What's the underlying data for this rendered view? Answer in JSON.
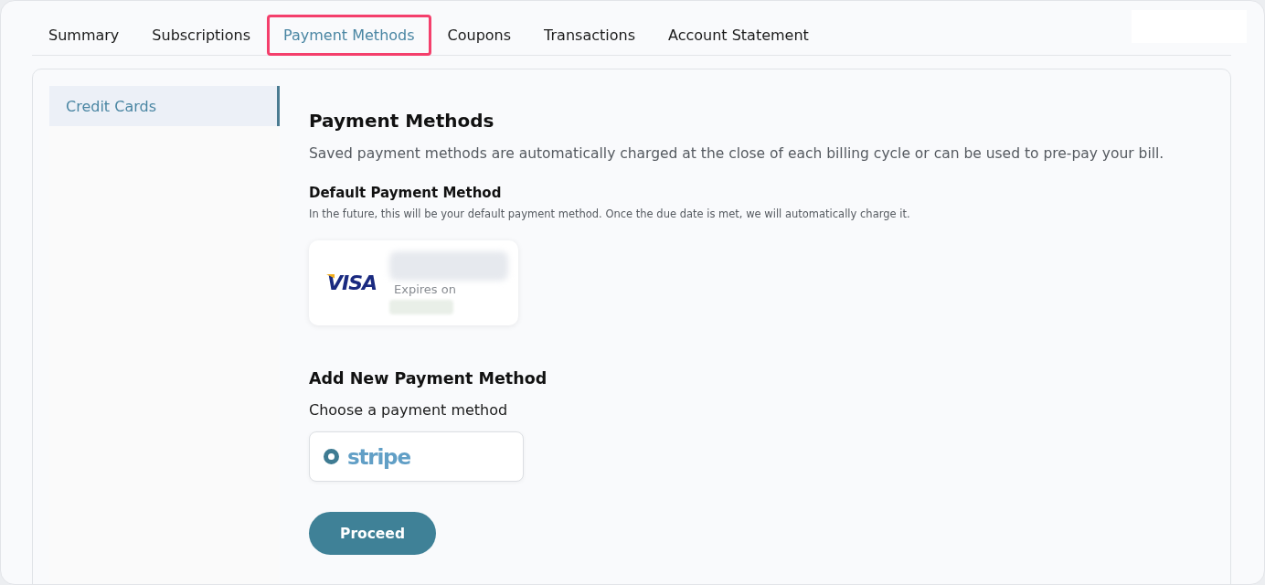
{
  "tabs": [
    {
      "label": "Summary",
      "selected": false
    },
    {
      "label": "Subscriptions",
      "selected": false
    },
    {
      "label": "Payment Methods",
      "selected": true
    },
    {
      "label": "Coupons",
      "selected": false
    },
    {
      "label": "Transactions",
      "selected": false
    },
    {
      "label": "Account Statement",
      "selected": false
    }
  ],
  "sidebar": {
    "items": [
      {
        "label": "Credit Cards",
        "selected": true
      }
    ]
  },
  "content": {
    "title": "Payment Methods",
    "description": "Saved payment methods are automatically charged at the close of each billing cycle or can be used to pre-pay your bill.",
    "default_method": {
      "heading": "Default Payment Method",
      "note": "In the future, this will be your default payment method. Once the due date is met, we will automatically charge it.",
      "card": {
        "brand": "VISA",
        "expiry_label": "Expires on"
      }
    },
    "add_method": {
      "heading": "Add New Payment Method",
      "prompt": "Choose a payment method",
      "options": [
        {
          "label": "stripe",
          "selected": true
        }
      ]
    },
    "proceed_button": "Proceed"
  }
}
